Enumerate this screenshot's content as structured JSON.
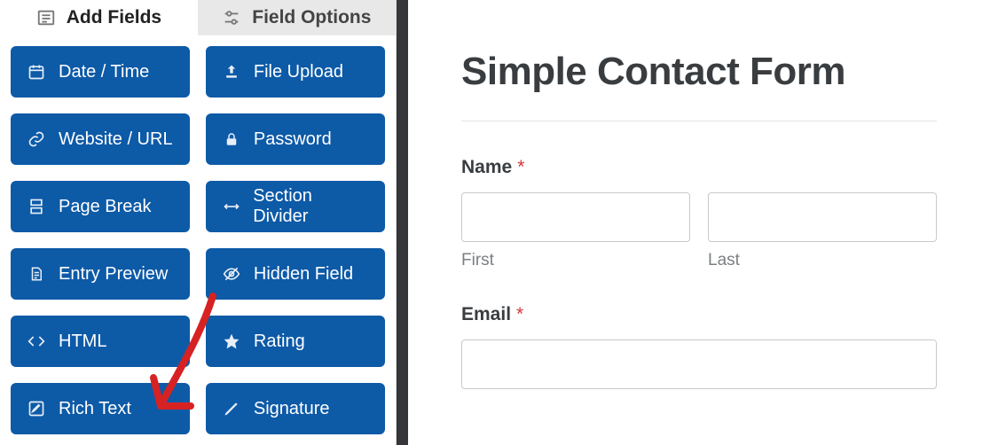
{
  "tabs": {
    "add_fields": "Add Fields",
    "field_options": "Field Options"
  },
  "fields": {
    "date_time": "Date / Time",
    "file_upload": "File Upload",
    "website_url": "Website / URL",
    "password": "Password",
    "page_break": "Page Break",
    "section_divider": "Section Divider",
    "entry_preview": "Entry Preview",
    "hidden_field": "Hidden Field",
    "html": "HTML",
    "rating": "Rating",
    "rich_text": "Rich Text",
    "signature": "Signature"
  },
  "form": {
    "title": "Simple Contact Form",
    "name_label": "Name",
    "first_sublabel": "First",
    "last_sublabel": "Last",
    "email_label": "Email",
    "required": "*"
  }
}
